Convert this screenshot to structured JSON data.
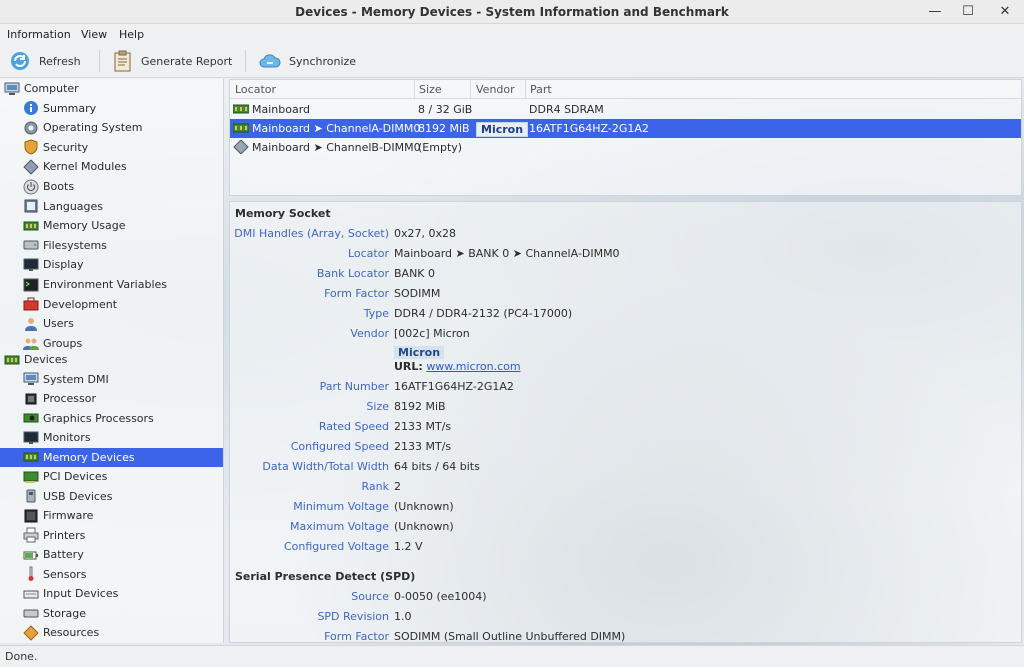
{
  "window": {
    "title": "Devices - Memory Devices - System Information and Benchmark",
    "minimize_glyph": "—",
    "maximize_glyph": "☐",
    "close_glyph": "✕"
  },
  "menubar": {
    "information": "Information",
    "view": "View",
    "help": "Help"
  },
  "toolbar": {
    "refresh": "Refresh",
    "generate_report": "Generate Report",
    "synchronize": "Synchronize"
  },
  "sidebar": {
    "computer": {
      "label": "Computer",
      "icon": "computer-icon",
      "items": [
        {
          "label": "Summary",
          "icon": "info-icon"
        },
        {
          "label": "Operating System",
          "icon": "gear-icon"
        },
        {
          "label": "Security",
          "icon": "shield-icon"
        },
        {
          "label": "Kernel Modules",
          "icon": "module-icon"
        },
        {
          "label": "Boots",
          "icon": "power-icon"
        },
        {
          "label": "Languages",
          "icon": "book-icon"
        },
        {
          "label": "Memory Usage",
          "icon": "memory-icon"
        },
        {
          "label": "Filesystems",
          "icon": "drive-icon"
        },
        {
          "label": "Display",
          "icon": "monitor-icon"
        },
        {
          "label": "Environment Variables",
          "icon": "terminal-icon"
        },
        {
          "label": "Development",
          "icon": "toolbox-icon"
        },
        {
          "label": "Users",
          "icon": "user-icon"
        },
        {
          "label": "Groups",
          "icon": "group-icon"
        }
      ]
    },
    "devices": {
      "label": "Devices",
      "icon": "devices-icon",
      "items": [
        {
          "label": "System DMI",
          "icon": "computer-icon"
        },
        {
          "label": "Processor",
          "icon": "cpu-icon"
        },
        {
          "label": "Graphics Processors",
          "icon": "gpu-icon"
        },
        {
          "label": "Monitors",
          "icon": "monitor-icon"
        },
        {
          "label": "Memory Devices",
          "icon": "memory-icon",
          "selected": true
        },
        {
          "label": "PCI Devices",
          "icon": "pci-icon"
        },
        {
          "label": "USB Devices",
          "icon": "usb-icon"
        },
        {
          "label": "Firmware",
          "icon": "firmware-icon"
        },
        {
          "label": "Printers",
          "icon": "printer-icon"
        },
        {
          "label": "Battery",
          "icon": "battery-icon"
        },
        {
          "label": "Sensors",
          "icon": "thermometer-icon"
        },
        {
          "label": "Input Devices",
          "icon": "keyboard-icon"
        },
        {
          "label": "Storage",
          "icon": "storage-icon"
        },
        {
          "label": "Resources",
          "icon": "resources-icon"
        }
      ]
    }
  },
  "device_list": {
    "columns": [
      "Locator",
      "Size",
      "Vendor",
      "Part"
    ],
    "rows": [
      {
        "locator": "Mainboard",
        "size": "8 / 32 GiB",
        "vendor": "",
        "part": "DDR4 SDRAM",
        "icon": "memory-icon"
      },
      {
        "locator": "Mainboard ➤ ChannelA-DIMM0",
        "size": "8192 MiB",
        "vendor": "Micron",
        "part": "16ATF1G64HZ-2G1A2",
        "icon": "memory-icon",
        "selected": true
      },
      {
        "locator": "Mainboard ➤ ChannelB-DIMM0",
        "size": "(Empty)",
        "vendor": "",
        "part": "",
        "icon": "empty-slot-icon"
      }
    ]
  },
  "details": {
    "memory_socket": {
      "title": "Memory Socket",
      "dmi_handles_label": "DMI Handles (Array, Socket)",
      "dmi_handles_value": "0x27, 0x28",
      "locator_label": "Locator",
      "locator_value": "Mainboard ➤ BANK 0 ➤ ChannelA-DIMM0",
      "bank_locator_label": "Bank Locator",
      "bank_locator_value": "BANK 0",
      "form_factor_label": "Form Factor",
      "form_factor_value": "SODIMM",
      "type_label": "Type",
      "type_value": "DDR4 / DDR4-2132 (PC4-17000)",
      "vendor_label": "Vendor",
      "vendor_value": "[002c] Micron",
      "vendor_badge": "Micron",
      "url_label": "URL:",
      "url_value": "www.micron.com",
      "part_number_label": "Part Number",
      "part_number_value": "16ATF1G64HZ-2G1A2",
      "size_label": "Size",
      "size_value": "8192 MiB",
      "rated_speed_label": "Rated Speed",
      "rated_speed_value": "2133 MT/s",
      "configured_speed_label": "Configured Speed",
      "configured_speed_value": "2133 MT/s",
      "data_width_label": "Data Width/Total Width",
      "data_width_value": "64 bits / 64 bits",
      "rank_label": "Rank",
      "rank_value": "2",
      "min_voltage_label": "Minimum Voltage",
      "min_voltage_value": "(Unknown)",
      "max_voltage_label": "Maximum Voltage",
      "max_voltage_value": "(Unknown)",
      "configured_voltage_label": "Configured Voltage",
      "configured_voltage_value": "1.2 V"
    },
    "spd": {
      "title": "Serial Presence Detect (SPD)",
      "source_label": "Source",
      "source_value": "0-0050 (ee1004)",
      "spd_revision_label": "SPD Revision",
      "spd_revision_value": "1.0",
      "form_factor_label": "Form Factor",
      "form_factor_value": "SODIMM (Small Outline Unbuffered DIMM)"
    }
  },
  "statusbar": {
    "text": "Done."
  },
  "colors": {
    "selection": "#3c64e8",
    "key_label": "#4066c2",
    "link": "#2a5bd1"
  }
}
